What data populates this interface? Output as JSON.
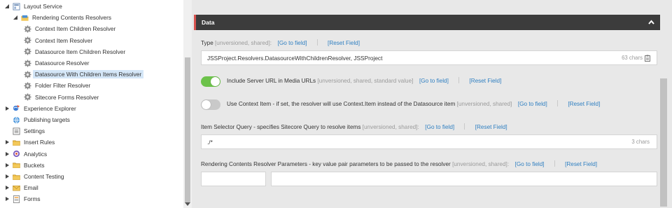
{
  "tree": {
    "items": [
      {
        "label": "Layout Service",
        "icon": "layout-icon",
        "expand": "down",
        "indent": 0
      },
      {
        "label": "Rendering Contents Resolvers",
        "icon": "folder-blue-icon",
        "expand": "down",
        "indent": 1
      },
      {
        "label": "Context Item Children Resolver",
        "icon": "gear-icon",
        "expand": "none",
        "indent": 2
      },
      {
        "label": "Context Item Resolver",
        "icon": "gear-icon",
        "expand": "none",
        "indent": 2
      },
      {
        "label": "Datasource Item Children Resolver",
        "icon": "gear-icon",
        "expand": "none",
        "indent": 2
      },
      {
        "label": "Datasource Resolver",
        "icon": "gear-icon",
        "expand": "none",
        "indent": 2
      },
      {
        "label": "Datasource With Children Items Resolver",
        "icon": "gear-icon",
        "expand": "none",
        "indent": 2,
        "selected": true
      },
      {
        "label": "Folder Filter Resolver",
        "icon": "gear-icon",
        "expand": "none",
        "indent": 2
      },
      {
        "label": "Sitecore Forms Resolver",
        "icon": "gear-icon",
        "expand": "none",
        "indent": 2
      },
      {
        "label": "Experience Explorer",
        "icon": "explorer-icon",
        "expand": "right",
        "indent": 0
      },
      {
        "label": "Publishing targets",
        "icon": "publishing-icon",
        "expand": "none",
        "indent": 0
      },
      {
        "label": "Settings",
        "icon": "settings-icon",
        "expand": "none",
        "indent": 0
      },
      {
        "label": "Insert Rules",
        "icon": "folder-icon",
        "expand": "right",
        "indent": 0
      },
      {
        "label": "Analytics",
        "icon": "analytics-icon",
        "expand": "right",
        "indent": 0
      },
      {
        "label": "Buckets",
        "icon": "folder-icon",
        "expand": "right",
        "indent": 0
      },
      {
        "label": "Content Testing",
        "icon": "folder-icon",
        "expand": "right",
        "indent": 0
      },
      {
        "label": "Email",
        "icon": "email-icon",
        "expand": "right",
        "indent": 0
      },
      {
        "label": "Forms",
        "icon": "forms-icon",
        "expand": "right",
        "indent": 0
      }
    ]
  },
  "section": {
    "title": "Data"
  },
  "fields": {
    "type": {
      "label": "Type",
      "meta": "[unversioned, shared]:",
      "goto": "[Go to field]",
      "reset": "[Reset Field]",
      "value": "JSSProject.Resolvers.DatasourceWithChildrenResolver, JSSProject",
      "count": "63 chars"
    },
    "include_server_url": {
      "label": "Include Server URL in Media URLs",
      "meta": "[unversioned, shared, standard value]",
      "goto": "[Go to field]",
      "reset": "[Reset Field]",
      "on": true
    },
    "use_context_item": {
      "label": "Use Context Item - if set, the resolver will use Context.Item instead of the Datasource item",
      "meta": "[unversioned, shared]",
      "goto": "[Go to field]",
      "reset": "[Reset Field]",
      "on": false
    },
    "item_selector_query": {
      "label": "Item Selector Query - specifies Sitecore Query to resolve items",
      "meta": "[unversioned, shared]:",
      "goto": "[Go to field]",
      "reset": "[Reset Field]",
      "value": "./*",
      "count": "3 chars"
    },
    "resolver_parameters": {
      "label": "Rendering Contents Resolver Parameters - key value pair parameters to be passed to the resolver",
      "meta": "[unversioned, shared]:",
      "goto": "[Go to field]",
      "reset": "[Reset Field]",
      "key": "",
      "value": ""
    }
  },
  "colors": {
    "toggle_on": "#6cc24a",
    "toggle_off": "#c9c9c9",
    "link": "#2f7fc1",
    "section_header_bg": "#3c3c3c",
    "section_accent": "#d9534f",
    "selected_row": "#d4e6f7"
  }
}
